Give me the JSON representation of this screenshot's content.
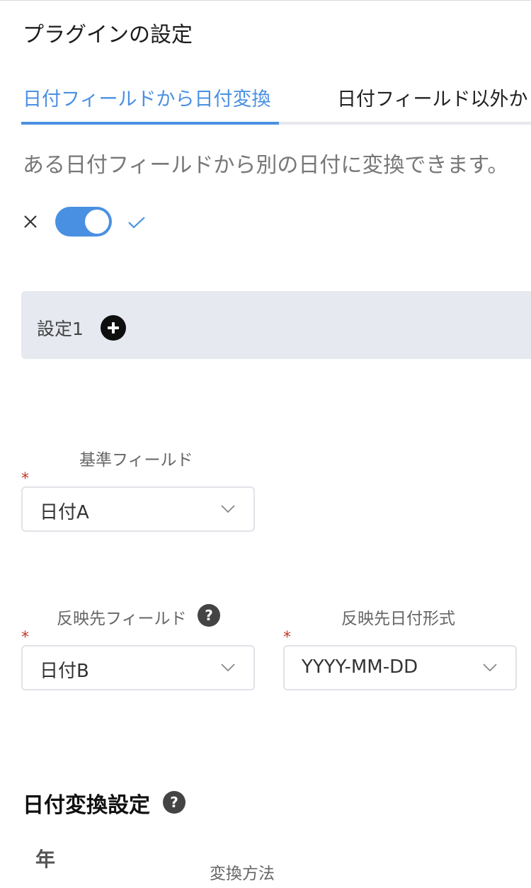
{
  "page": {
    "title": "プラグインの設定"
  },
  "tabs": [
    {
      "label": "日付フィールドから日付変換",
      "active": true
    },
    {
      "label": "日付フィールド以外か",
      "active": false
    }
  ],
  "description": "ある日付フィールドから別の日付に変換できます。",
  "toggle": {
    "enabled": true,
    "off_icon": "close-icon",
    "on_icon": "check-icon",
    "accent": "#4a90e2"
  },
  "setting": {
    "label": "設定1",
    "add_icon": "add-circle-icon"
  },
  "fields": {
    "base": {
      "label": "基準フィールド",
      "value": "日付A",
      "required_mark": "*"
    },
    "target": {
      "label": "反映先フィールド",
      "value": "日付B",
      "required_mark": "*",
      "help": "?"
    },
    "format": {
      "label": "反映先日付形式",
      "value": "YYYY-MM-DD",
      "required_mark": "*"
    }
  },
  "conversion": {
    "title": "日付変換設定",
    "help": "?",
    "unit_label": "年",
    "method_label": "変換方法"
  }
}
